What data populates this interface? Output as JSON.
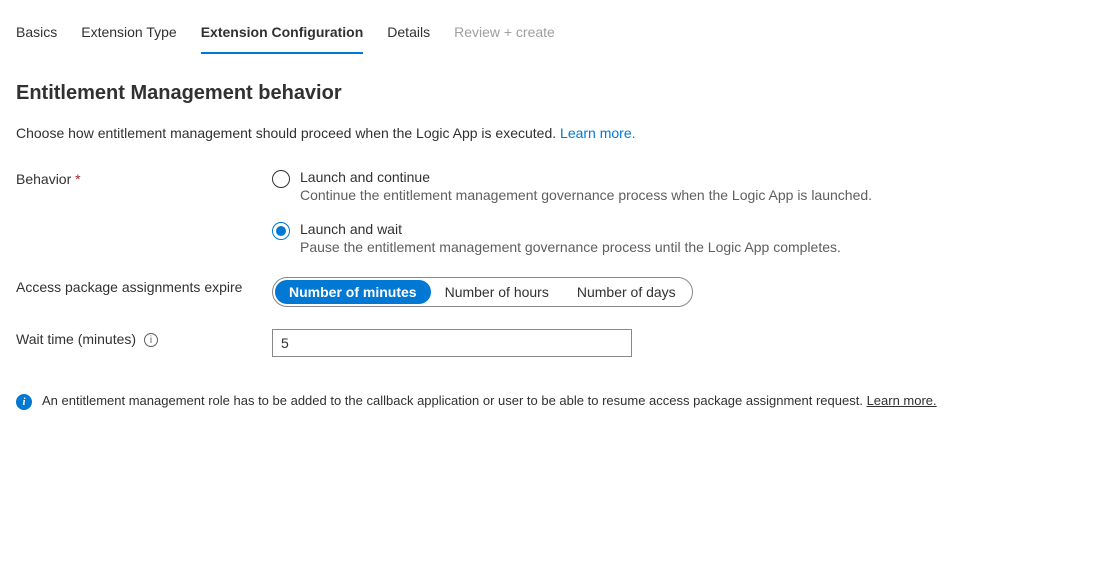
{
  "tabs": {
    "basics": "Basics",
    "extension_type": "Extension Type",
    "extension_configuration": "Extension Configuration",
    "details": "Details",
    "review_create": "Review + create"
  },
  "section": {
    "title": "Entitlement Management behavior",
    "description": "Choose how entitlement management should proceed when the Logic App is executed. ",
    "learn_more": "Learn more."
  },
  "behavior": {
    "label": "Behavior ",
    "required_mark": "*",
    "opt_continue": {
      "label": "Launch and continue",
      "desc": "Continue the entitlement management governance process when the Logic App is launched."
    },
    "opt_wait": {
      "label": "Launch and wait",
      "desc": "Pause the entitlement management governance process until the Logic App completes."
    }
  },
  "expire": {
    "label": "Access package assignments expire",
    "minutes": "Number of minutes",
    "hours": "Number of hours",
    "days": "Number of days"
  },
  "wait_time": {
    "label": "Wait time (minutes)",
    "value": "5"
  },
  "banner": {
    "text": "An entitlement management role has to be added to the callback application or user to be able to resume access package assignment request. ",
    "learn_more": "Learn more."
  }
}
